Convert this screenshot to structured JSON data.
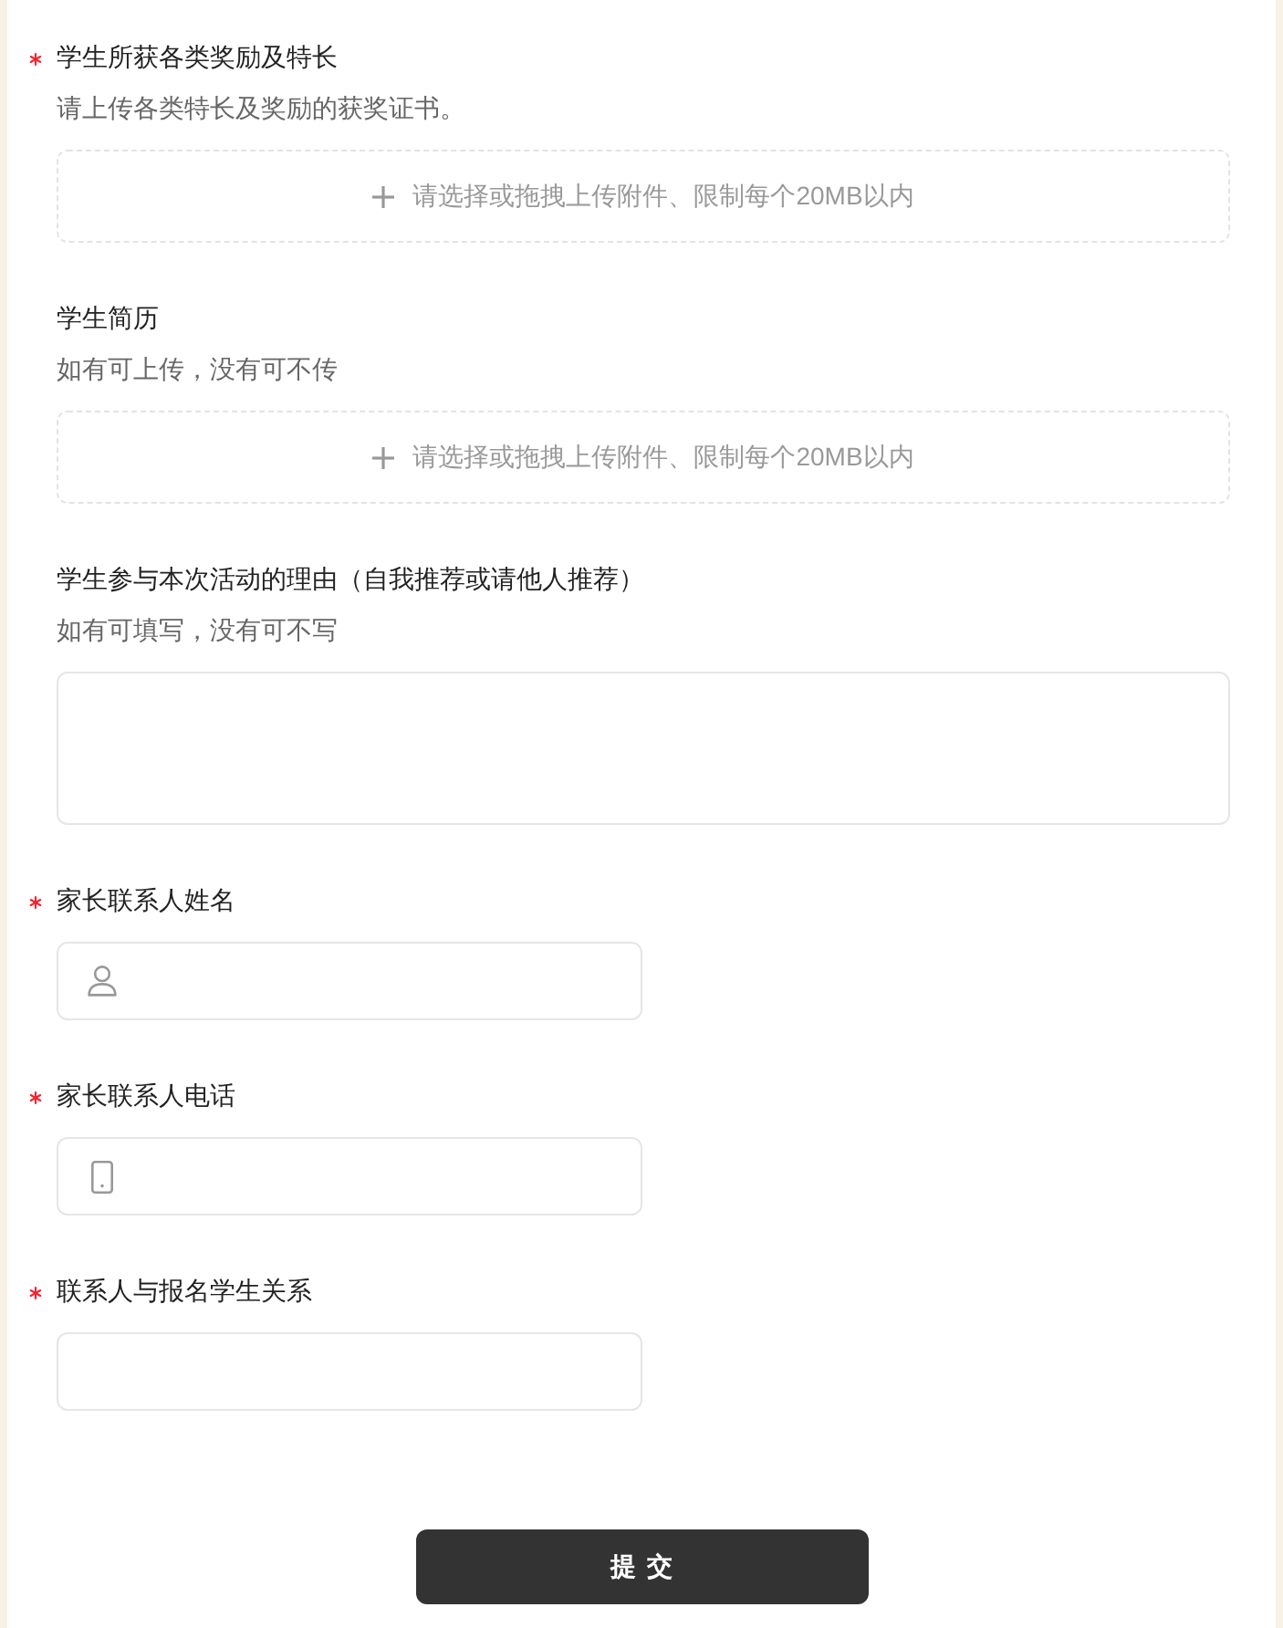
{
  "fields": [
    {
      "kind": "upload",
      "required": true,
      "label": "学生所获各类奖励及特长",
      "hint": "请上传各类特长及奖励的获奖证书。",
      "prompt": "请选择或拖拽上传附件、限制每个20MB以内"
    },
    {
      "kind": "upload",
      "required": false,
      "label": "学生简历",
      "hint": "如有可上传，没有可不传",
      "prompt": "请选择或拖拽上传附件、限制每个20MB以内"
    },
    {
      "kind": "textarea",
      "required": false,
      "label": "学生参与本次活动的理由（自我推荐或请他人推荐）",
      "hint": "如有可填写，没有可不写"
    },
    {
      "kind": "name",
      "required": true,
      "label": "家长联系人姓名"
    },
    {
      "kind": "phone",
      "required": true,
      "label": "家长联系人电话"
    },
    {
      "kind": "text",
      "required": true,
      "label": "联系人与报名学生关系"
    }
  ],
  "submit": {
    "label": "提交"
  }
}
